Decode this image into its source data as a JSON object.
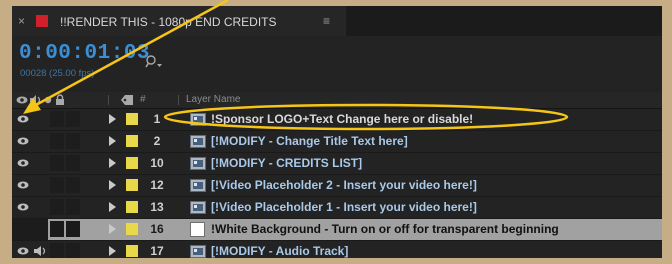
{
  "tab": {
    "close_glyph": "×",
    "title": "!!RENDER THIS - 1080p END CREDITS",
    "menu_glyph": "≡",
    "swatch_color": "#d0202a"
  },
  "time": {
    "timecode": "0:00:01:03",
    "frames_fps": "00028 (25.00 fps)"
  },
  "search": {
    "icon": "search-icon"
  },
  "header": {
    "hash": "#",
    "layer_name": "Layer Name"
  },
  "layers": [
    {
      "num": "1",
      "name": "!Sponsor LOGO+Text Change here or disable!",
      "eye": true,
      "audio": false,
      "icon": "image-layer-icon"
    },
    {
      "num": "2",
      "name": "[!MODIFY - Change Title Text  here]",
      "eye": true,
      "audio": false,
      "icon": "image-layer-icon"
    },
    {
      "num": "10",
      "name": "[!MODIFY - CREDITS LIST]",
      "eye": true,
      "audio": false,
      "icon": "image-layer-icon"
    },
    {
      "num": "12",
      "name": "[!Video Placeholder 2 - Insert your video here!]",
      "eye": true,
      "audio": false,
      "icon": "image-layer-icon"
    },
    {
      "num": "13",
      "name": "[!Video Placeholder 1 - Insert your video here!]",
      "eye": true,
      "audio": false,
      "icon": "image-layer-icon"
    },
    {
      "num": "16",
      "name": "!White Background - Turn on or off for transparent beginning",
      "eye": false,
      "audio": false,
      "icon": "solid-layer-icon",
      "selected": true
    },
    {
      "num": "17",
      "name": "[!MODIFY - Audio Track]",
      "eye": true,
      "audio": true,
      "icon": "image-layer-icon"
    }
  ],
  "colors": {
    "label_yellow": "#e9d94a",
    "timecode_blue": "#3a8fd6",
    "annotation_yellow": "#f5c518"
  }
}
